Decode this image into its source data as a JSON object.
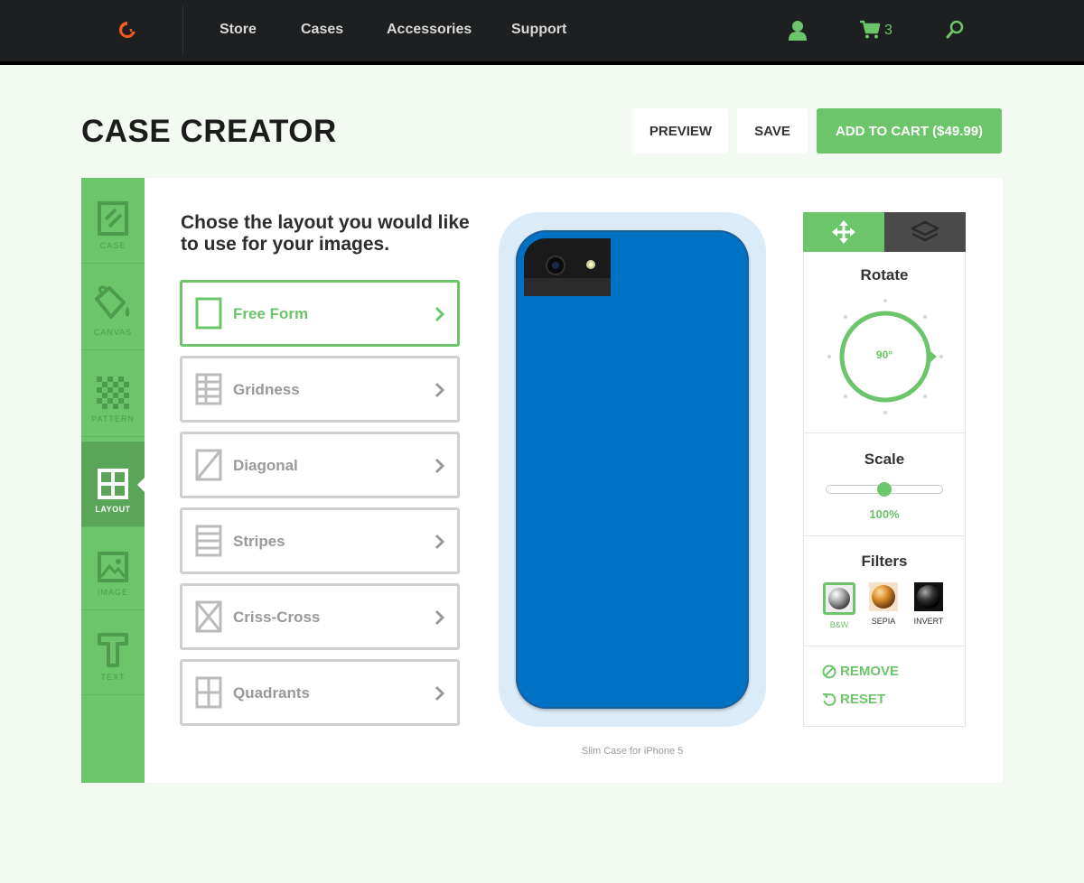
{
  "nav": {
    "links": [
      "Store",
      "Cases",
      "Accessories",
      "Support"
    ],
    "cart_count": "3"
  },
  "header": {
    "title": "CASE CREATOR",
    "preview_label": "PREVIEW",
    "save_label": "SAVE",
    "add_to_cart_label": "ADD TO CART  ($49.99)"
  },
  "tools": [
    {
      "label": "CASE",
      "icon": "case-icon"
    },
    {
      "label": "CANVAS",
      "icon": "paint-bucket-icon"
    },
    {
      "label": "PATTERN",
      "icon": "checkerboard-icon"
    },
    {
      "label": "LAYOUT",
      "icon": "grid-icon",
      "active": true
    },
    {
      "label": "IMAGE",
      "icon": "image-icon"
    },
    {
      "label": "TEXT",
      "icon": "text-icon"
    }
  ],
  "layout_picker": {
    "prompt": "Chose the layout you would like to use for your images.",
    "options": [
      {
        "label": "Free Form",
        "selected": true
      },
      {
        "label": "Gridness"
      },
      {
        "label": "Diagonal"
      },
      {
        "label": "Stripes"
      },
      {
        "label": "Criss-Cross"
      },
      {
        "label": "Quadrants"
      }
    ]
  },
  "preview": {
    "caption": "Slim Case for iPhone 5",
    "case_color": "#0072c6"
  },
  "panel": {
    "tabs": [
      {
        "icon": "move-icon",
        "active": true
      },
      {
        "icon": "layers-icon"
      }
    ],
    "rotate": {
      "title": "Rotate",
      "value": "90°"
    },
    "scale": {
      "title": "Scale",
      "value": "100%",
      "level": 0.5
    },
    "filters": {
      "title": "Filters",
      "items": [
        {
          "label": "B&W",
          "active": true
        },
        {
          "label": "SEPIA"
        },
        {
          "label": "INVERT"
        }
      ]
    },
    "remove_label": "REMOVE",
    "reset_label": "RESET"
  },
  "colors": {
    "accent": "#6cc56a",
    "nav_bg": "#1d1f20",
    "logo": "#f05a1e"
  }
}
